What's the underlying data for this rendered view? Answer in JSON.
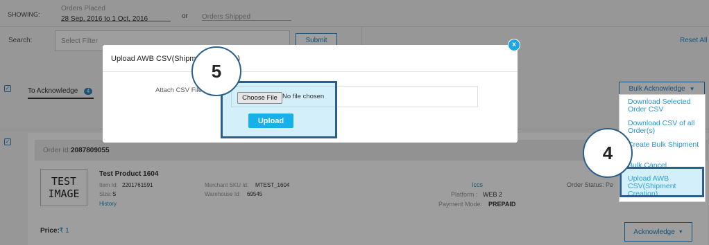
{
  "filters": {
    "showing_label": "SHOWING:",
    "orders_placed_label": "Orders Placed",
    "orders_placed_value": "28 Sep, 2016 to 1 Oct, 2016",
    "or_label": "or",
    "orders_shipped_placeholder": "Orders Shipped",
    "search_label": "Search:",
    "select_filter_placeholder": "Select Filter",
    "submit_label": "Submit",
    "reset_all_label": "Reset All"
  },
  "tabs": {
    "to_acknowledge_label": "To Acknowledge",
    "to_acknowledge_count": "4"
  },
  "bulk": {
    "button_label": "Bulk Acknowledge",
    "menu_items": [
      "Download Selected Order CSV",
      "Download CSV of all Order(s)",
      "Create Bulk Shipment",
      "Bulk Cancel",
      "Upload AWB CSV(Shipment Creation)"
    ]
  },
  "order": {
    "order_id_label": "Order Id:",
    "order_id": "2087809055",
    "image_text": "TEST IMAGE",
    "product_name": "Test Product  1604",
    "item_id_label": "Item Id:",
    "item_id": "2201761591",
    "size_label": "Size:",
    "size": "S",
    "history_label": "History",
    "merchant_sku_label": "Merchant SKU Id:",
    "merchant_sku": "MTEST_1604",
    "warehouse_label": "Warehouse Id:",
    "warehouse": "69545",
    "courier": "Iccs",
    "platform_label": "Platform :",
    "platform": "WEB 2",
    "payment_label": "Payment Mode:",
    "payment": "PREPAID",
    "status_label": "Order Status: Pe",
    "price_label": "Price:",
    "price": "₹ 1",
    "acknowledge_label": "Acknowledge"
  },
  "modal": {
    "title": "Upload AWB CSV(Shipment Creation)",
    "attach_label": "Attach CSV File :",
    "choose_file_label": "Choose File",
    "no_file_label": "No file chosen",
    "upload_label": "Upload",
    "close_glyph": "x"
  },
  "callouts": {
    "step4": "4",
    "step5": "5"
  },
  "colors": {
    "accent": "#2a84c0",
    "upload_button": "#17b0e8",
    "callout_border": "#2e5c86"
  }
}
